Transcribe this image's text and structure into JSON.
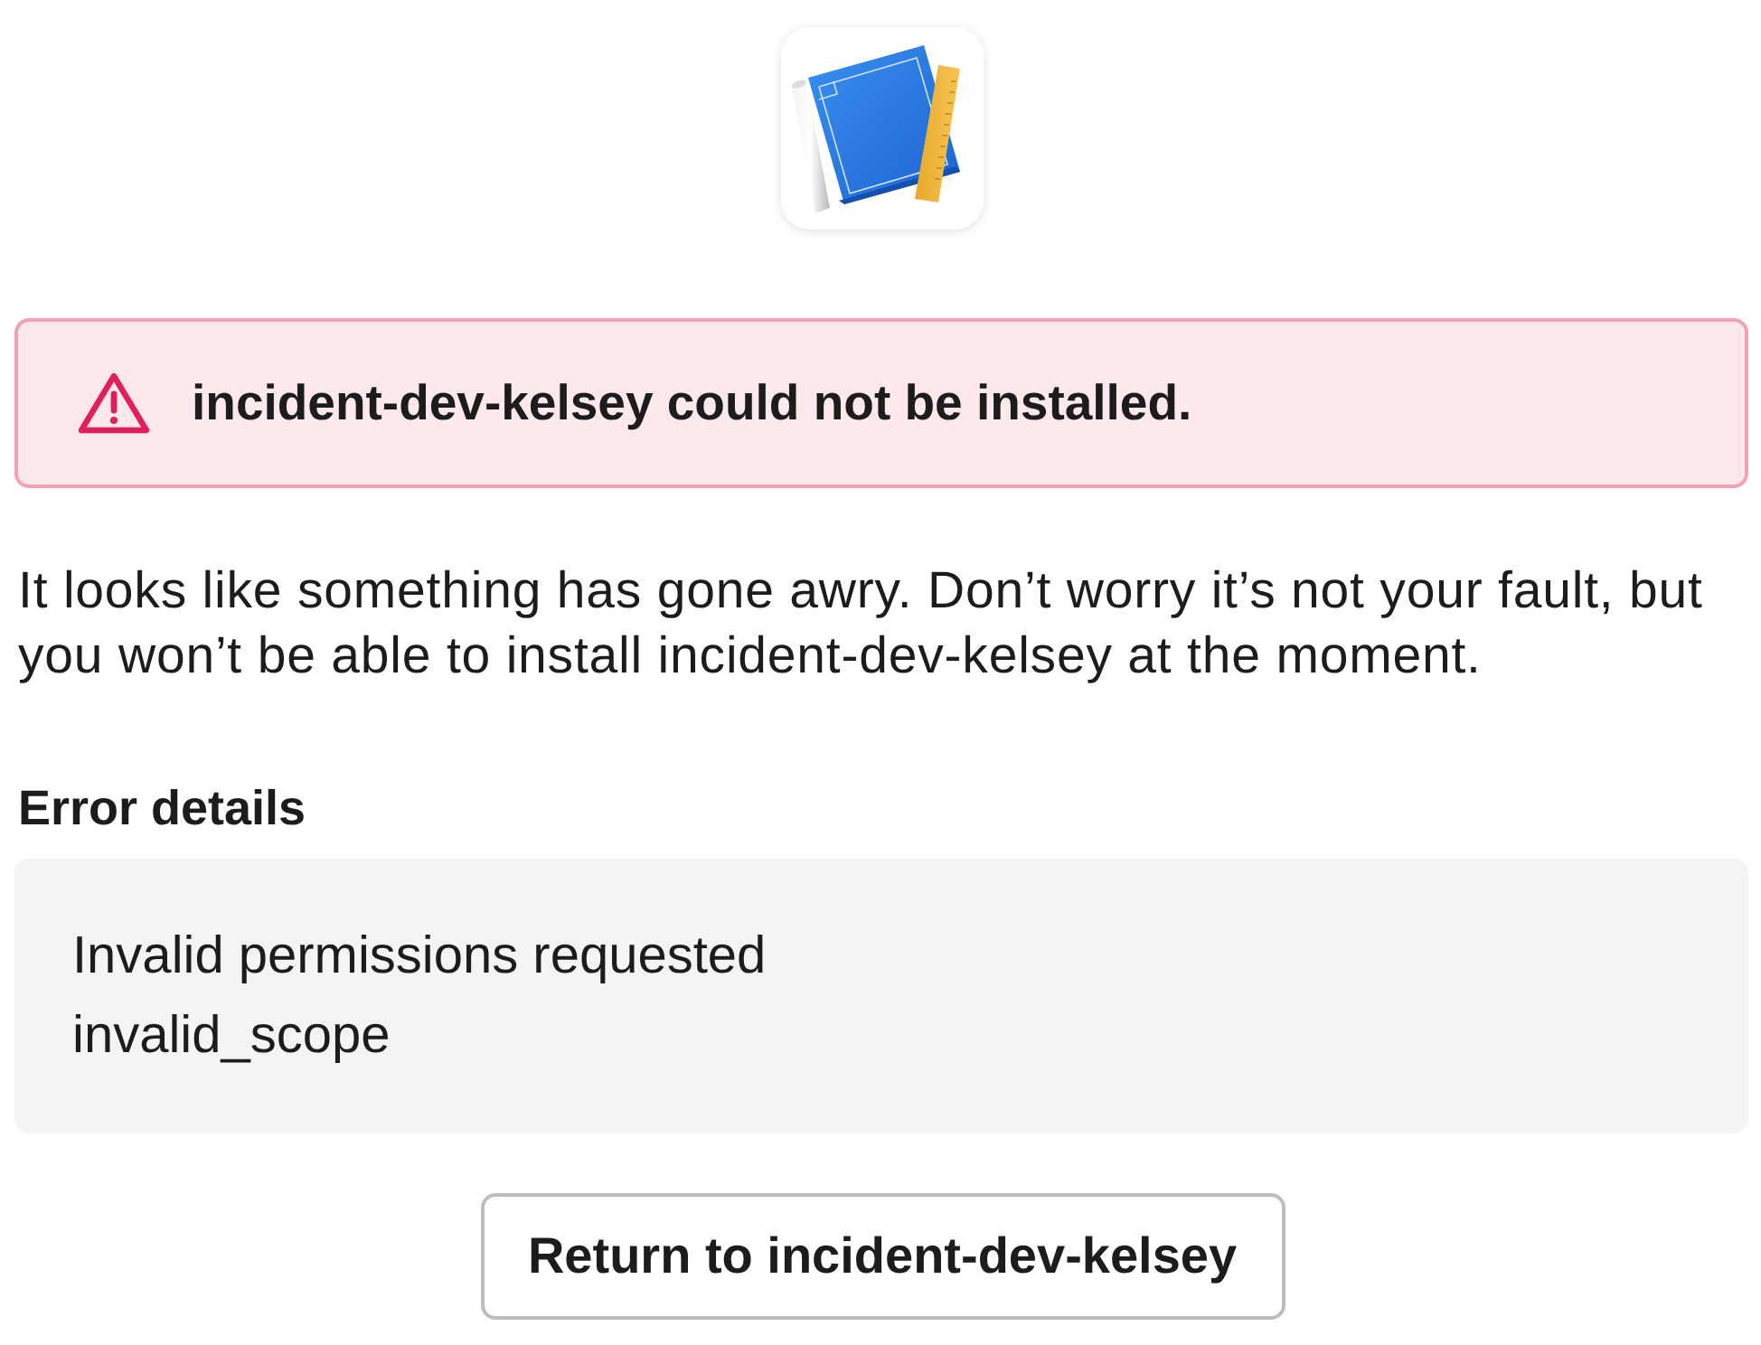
{
  "alert": {
    "kind": "error",
    "message": "incident-dev-kelsey could not be installed."
  },
  "description": "It looks like something has gone awry. Don’t worry it’s not your fault, but you won’t be able to install incident-dev-kelsey at the moment.",
  "error_details": {
    "heading": "Error details",
    "lines": [
      "Invalid permissions requested",
      "invalid_scope"
    ]
  },
  "button": {
    "label": "Return to incident-dev-kelsey"
  }
}
